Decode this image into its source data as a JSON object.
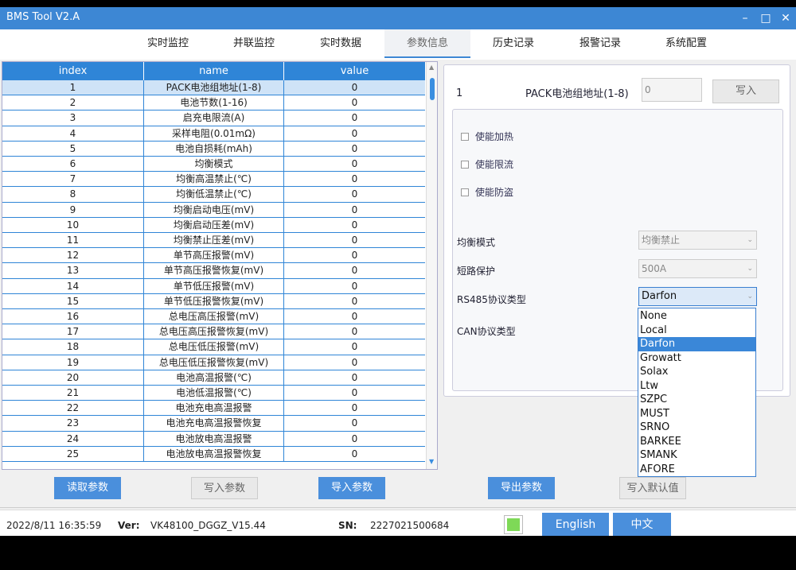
{
  "app": {
    "title": "BMS Tool V2.A",
    "window_controls": [
      "–",
      "□",
      "✕"
    ]
  },
  "tabs": [
    "实时监控",
    "并联监控",
    "实时数据",
    "参数信息",
    "历史记录",
    "报警记录",
    "系统配置"
  ],
  "active_tab": "参数信息",
  "table": {
    "headers": [
      "index",
      "name",
      "value"
    ],
    "rows": [
      [
        "1",
        "PACK电池组地址(1-8)",
        "0"
      ],
      [
        "2",
        "电池节数(1-16)",
        "0"
      ],
      [
        "3",
        "启充电限流(A)",
        "0"
      ],
      [
        "4",
        "采样电阻(0.01mΩ)",
        "0"
      ],
      [
        "5",
        "电池自损耗(mAh)",
        "0"
      ],
      [
        "6",
        "均衡模式",
        "0"
      ],
      [
        "7",
        "均衡高温禁止(℃)",
        "0"
      ],
      [
        "8",
        "均衡低温禁止(℃)",
        "0"
      ],
      [
        "9",
        "均衡启动电压(mV)",
        "0"
      ],
      [
        "10",
        "均衡启动压差(mV)",
        "0"
      ],
      [
        "11",
        "均衡禁止压差(mV)",
        "0"
      ],
      [
        "12",
        "单节高压报警(mV)",
        "0"
      ],
      [
        "13",
        "单节高压报警恢复(mV)",
        "0"
      ],
      [
        "14",
        "单节低压报警(mV)",
        "0"
      ],
      [
        "15",
        "单节低压报警恢复(mV)",
        "0"
      ],
      [
        "16",
        "总电压高压报警(mV)",
        "0"
      ],
      [
        "17",
        "总电压高压报警恢复(mV)",
        "0"
      ],
      [
        "18",
        "总电压低压报警(mV)",
        "0"
      ],
      [
        "19",
        "总电压低压报警恢复(mV)",
        "0"
      ],
      [
        "20",
        "电池高温报警(℃)",
        "0"
      ],
      [
        "21",
        "电池低温报警(℃)",
        "0"
      ],
      [
        "22",
        "电池充电高温报警",
        "0"
      ],
      [
        "23",
        "电池充电高温报警恢复",
        "0"
      ],
      [
        "24",
        "电池放电高温报警",
        "0"
      ],
      [
        "25",
        "电池放电高温报警恢复",
        "0"
      ]
    ]
  },
  "detail": {
    "index": "1",
    "param_name": "PACK电池组地址(1-8)",
    "value": "0",
    "write_button": "写入",
    "checkboxes": [
      "使能加热",
      "使能限流",
      "使能防盗"
    ],
    "balance_mode_label": "均衡模式",
    "balance_mode_value": "均衡禁止",
    "short_circuit_label": "短路保护",
    "short_circuit_value": "500A",
    "rs485_label": "RS485协议类型",
    "rs485_value": "Darfon",
    "can_label": "CAN协议类型",
    "rs485_options": [
      "None",
      "Local",
      "Darfon",
      "Growatt",
      "Solax",
      "Ltw",
      "SZPC",
      "MUST",
      "SRNO",
      "BARKEE",
      "SMANK",
      "AFORE"
    ],
    "rs485_selected": "Darfon"
  },
  "buttons": {
    "read": "读取参数",
    "write": "写入参数",
    "import": "导入参数",
    "export": "导出参数",
    "write_default": "写入默认值"
  },
  "status": {
    "datetime": "2022/8/11 16:35:59",
    "ver_label": "Ver:",
    "ver_value": "VK48100_DGGZ_V15.44",
    "sn_label": "SN:",
    "sn_value": "2227021500684",
    "lang_en": "English",
    "lang_zh": "中文",
    "indicator_color": "#7ed957"
  }
}
